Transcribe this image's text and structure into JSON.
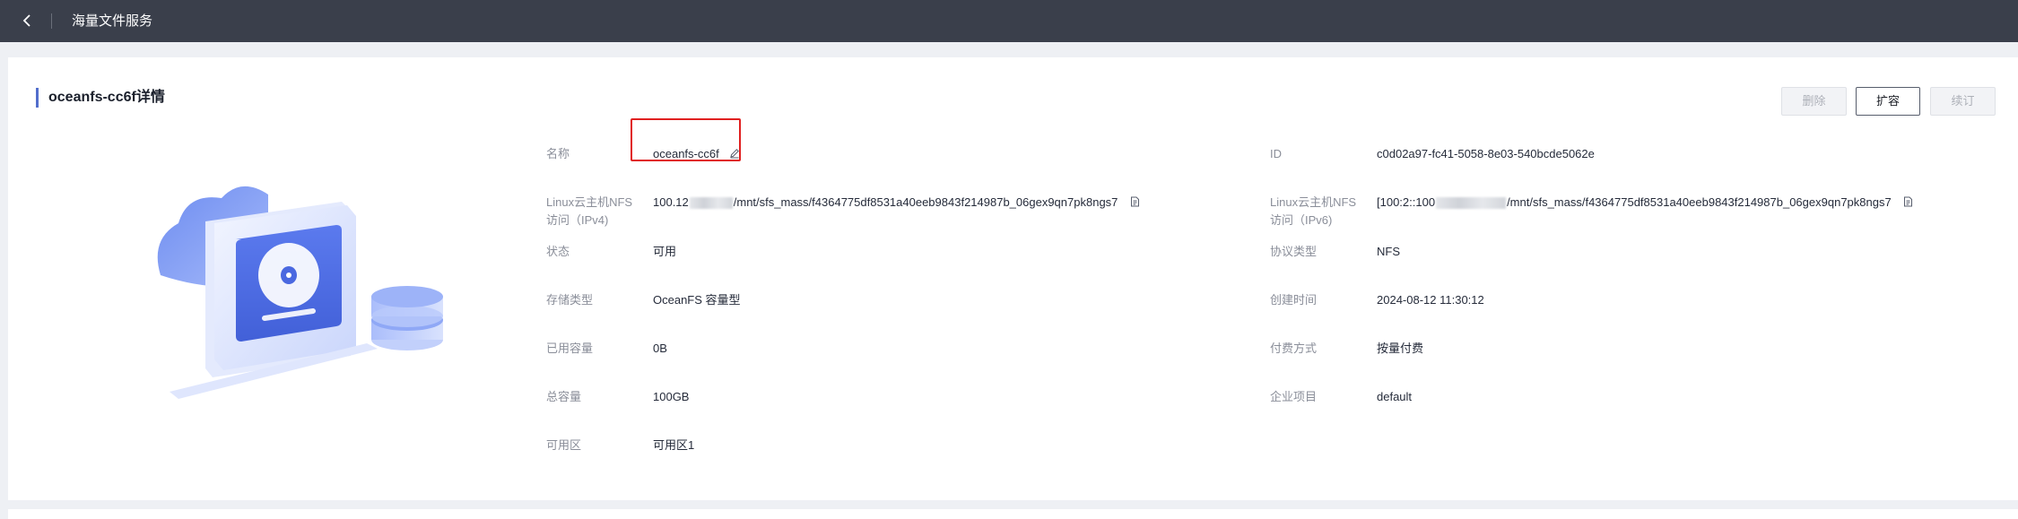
{
  "topbar": {
    "title": "海量文件服务"
  },
  "card": {
    "title": "oceanfs-cc6f详情"
  },
  "actions": {
    "delete": "删除",
    "expand": "扩容",
    "renew": "续订"
  },
  "details_left": {
    "name": {
      "label": "名称",
      "value": "oceanfs-cc6f"
    },
    "ipv4": {
      "label_line1": "Linux云主机NFS",
      "label_line2": "访问（IPv4)",
      "prefix": "100.12",
      "suffix": "/mnt/sfs_mass/f4364775df8531a40eeb9843f214987b_06gex9qn7pk8ngs7"
    },
    "status": {
      "label": "状态",
      "value": "可用"
    },
    "storage_type": {
      "label": "存储类型",
      "value": "OceanFS 容量型"
    },
    "used": {
      "label": "已用容量",
      "value": "0B"
    },
    "total": {
      "label": "总容量",
      "value": "100GB"
    },
    "az": {
      "label": "可用区",
      "value": "可用区1"
    }
  },
  "details_right": {
    "id": {
      "label": "ID",
      "value": "c0d02a97-fc41-5058-8e03-540bcde5062e"
    },
    "ipv6": {
      "label_line1": "Linux云主机NFS",
      "label_line2": "访问（IPv6)",
      "prefix": "[100:2::100",
      "suffix": "/mnt/sfs_mass/f4364775df8531a40eeb9843f214987b_06gex9qn7pk8ngs7"
    },
    "protocol": {
      "label": "协议类型",
      "value": "NFS"
    },
    "created": {
      "label": "创建时间",
      "value": "2024-08-12 11:30:12"
    },
    "billing": {
      "label": "付费方式",
      "value": "按量付费"
    },
    "project": {
      "label": "企业项目",
      "value": "default"
    }
  },
  "icons": {
    "back": "chevron-left-icon",
    "edit": "edit-pencil-icon",
    "copy": "copy-icon"
  },
  "colors": {
    "topbar": "#3a3f4b",
    "accent": "#526ecc",
    "highlight": "#e02020"
  }
}
